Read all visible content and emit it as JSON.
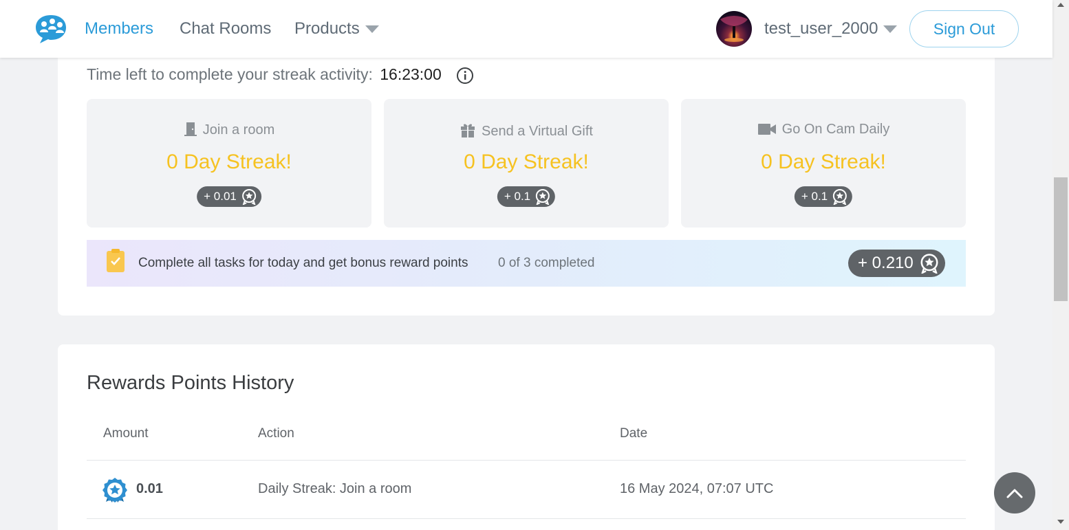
{
  "header": {
    "nav": {
      "members": "Members",
      "chat_rooms": "Chat Rooms",
      "products": "Products"
    },
    "user": {
      "name": "test_user_2000"
    },
    "sign_out": "Sign Out"
  },
  "streak": {
    "time_left_label": "Time left to complete your streak activity:",
    "time_left_value": "16:23:00",
    "tasks": [
      {
        "title": "Join a room",
        "streak": "0 Day Streak!",
        "points": "+ 0.01",
        "icon": "door-icon"
      },
      {
        "title": "Send a Virtual Gift",
        "streak": "0 Day Streak!",
        "points": "+ 0.1",
        "icon": "gift-icon"
      },
      {
        "title": "Go On Cam Daily",
        "streak": "0 Day Streak!",
        "points": "+ 0.1",
        "icon": "video-camera-icon"
      }
    ],
    "bonus": {
      "text": "Complete all tasks for today and get bonus reward points",
      "progress": "0 of 3 completed",
      "points": "+ 0.210"
    }
  },
  "history": {
    "title": "Rewards Points History",
    "columns": {
      "amount": "Amount",
      "action": "Action",
      "date": "Date"
    },
    "rows": [
      {
        "amount": "0.01",
        "action": "Daily Streak: Join a room",
        "date": "16 May 2024, 07:07 UTC"
      }
    ]
  },
  "colors": {
    "accent": "#2b9bd8",
    "streak_yellow": "#f6c221",
    "pill_gray": "#5f6367"
  }
}
